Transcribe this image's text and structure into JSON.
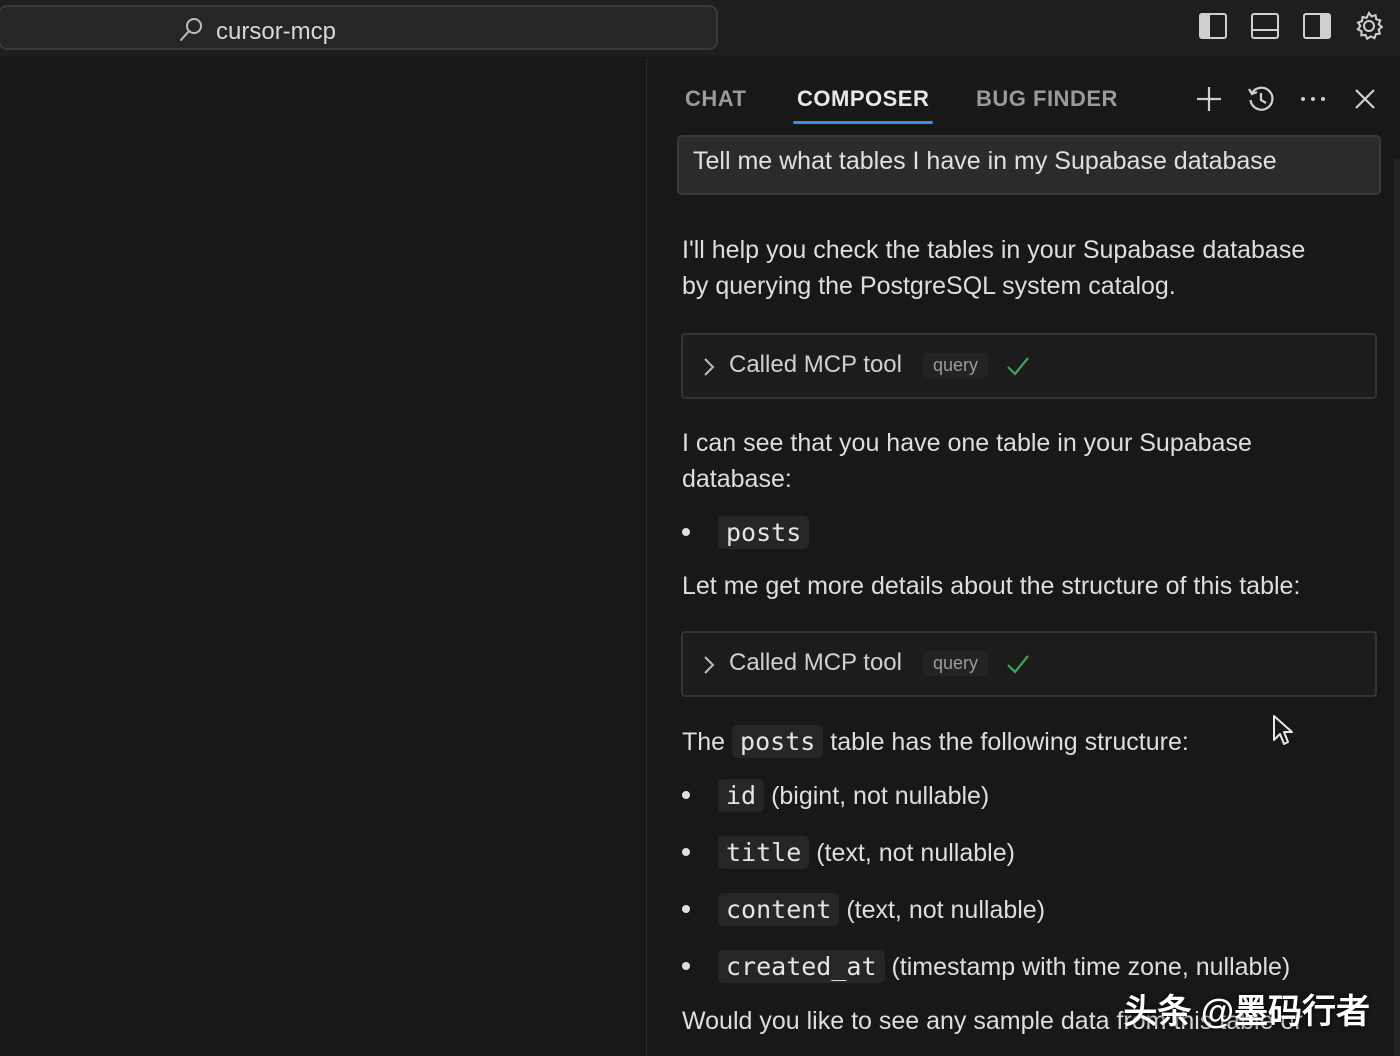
{
  "titlebar": {
    "search_text": "cursor-mcp",
    "icons": [
      "toggle-primary-sidebar-icon",
      "toggle-panel-icon",
      "toggle-secondary-sidebar-icon",
      "settings-gear-icon"
    ]
  },
  "panel": {
    "tabs": [
      {
        "label": "CHAT",
        "active": false
      },
      {
        "label": "COMPOSER",
        "active": true
      },
      {
        "label": "BUG FINDER",
        "active": false
      }
    ],
    "actions": [
      "plus-icon",
      "history-icon",
      "more-icon",
      "close-icon"
    ],
    "accent_color": "#3b8eea",
    "user_message": "Tell me what tables I have in my Supabase database",
    "messages": {
      "intro_line1": "I'll help you check the tables in your Supabase database",
      "intro_line2": "by querying the PostgreSQL system catalog.",
      "tool_call_1": {
        "label": "Called MCP tool",
        "tag": "query",
        "status": "✓"
      },
      "found_line1": "I can see that you have one table in your Supabase",
      "found_line2": "database:",
      "table_name": "posts",
      "details_line": "Let me get more details about the structure of this table:",
      "tool_call_2": {
        "label": "Called MCP tool",
        "tag": "query",
        "status": "✓"
      },
      "structure_pre": "The",
      "structure_code": "posts",
      "structure_post": "table has the following structure:",
      "columns": [
        {
          "name": "id",
          "desc": "(bigint, not nullable)"
        },
        {
          "name": "title",
          "desc": "(text, not nullable)"
        },
        {
          "name": "content",
          "desc": "(text, not nullable)"
        },
        {
          "name": "created_at",
          "desc": "(timestamp with time zone, nullable)"
        }
      ],
      "closing_line": "Would you like to see any sample data from this table or"
    }
  },
  "watermark": "头条 @墨码行者"
}
